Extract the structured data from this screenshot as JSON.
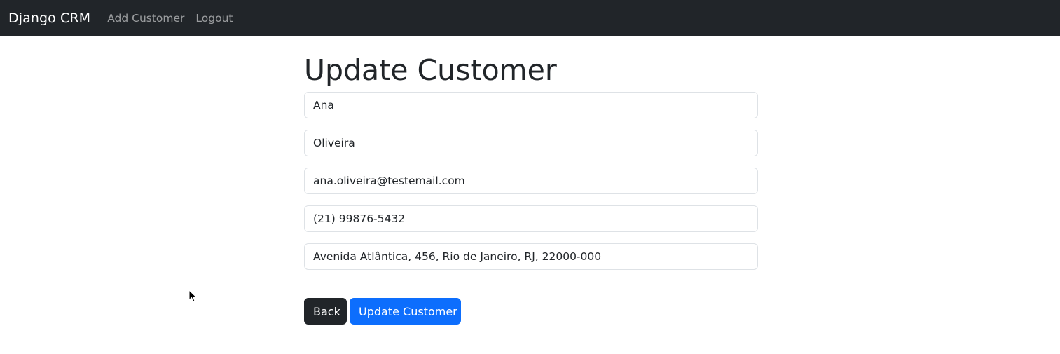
{
  "navbar": {
    "brand": "Django CRM",
    "links": [
      {
        "label": "Add Customer"
      },
      {
        "label": "Logout"
      }
    ]
  },
  "page": {
    "title": "Update Customer"
  },
  "form": {
    "first_name": "Ana",
    "last_name": "Oliveira",
    "email": "ana.oliveira@testemail.com",
    "phone": "(21) 99876-5432",
    "address": "Avenida Atlântica, 456, Rio de Janeiro, RJ, 22000-000"
  },
  "actions": {
    "back_label": "Back",
    "update_label": "Update Customer"
  },
  "colors": {
    "navbar_bg": "#212529",
    "primary": "#0d6efd",
    "dark_button": "#212529"
  },
  "icons": {
    "cursor": "mouse-pointer-icon"
  }
}
